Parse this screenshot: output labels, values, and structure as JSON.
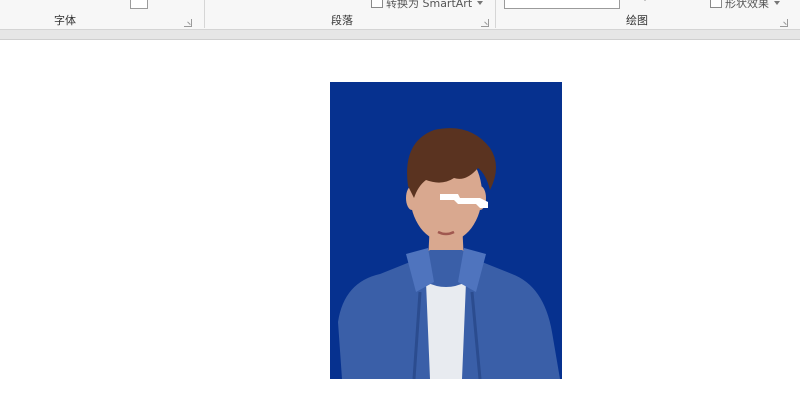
{
  "ribbon": {
    "groups": [
      {
        "label": "字体"
      },
      {
        "label": "段落"
      },
      {
        "label": "绘图"
      }
    ],
    "commands": {
      "smartart": "转换为 SmartArt",
      "shape_effects": "形状效果"
    }
  },
  "photo": {
    "background_color": "#06318f",
    "shirt_color": "#3a5fa8",
    "undershirt_color": "#e8ebf0",
    "hair_color": "#5a3320",
    "skin_color": "#d9a88f",
    "eye_bar_color": "#ffffff"
  }
}
